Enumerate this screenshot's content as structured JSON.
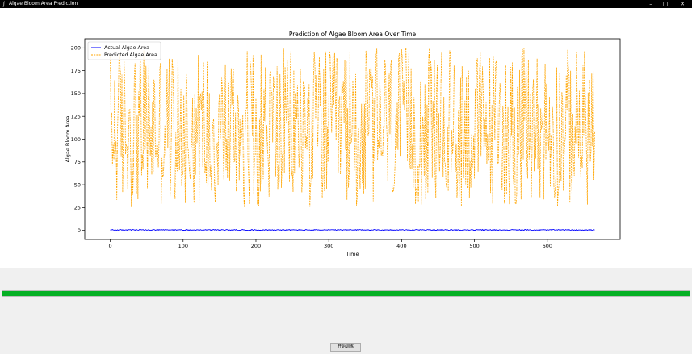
{
  "window": {
    "title": "Algae Bloom Area Prediction",
    "controls": {
      "minimize": "–",
      "maximize": "▢",
      "close": "✕"
    },
    "icon": "feather-icon"
  },
  "chart_data": {
    "type": "line",
    "title": "Prediction of Algae Bloom Area Over Time",
    "xlabel": "Time",
    "ylabel": "Algae Bloom Area",
    "xlim": [
      -35,
      700
    ],
    "ylim": [
      -10,
      210
    ],
    "xticks": [
      0,
      100,
      200,
      300,
      400,
      500,
      600
    ],
    "yticks": [
      0,
      25,
      50,
      75,
      100,
      125,
      150,
      175,
      200
    ],
    "grid": false,
    "legend_position": "top-left",
    "series": [
      {
        "name": "Actual Algae Area",
        "color": "#0000ff",
        "style": "solid",
        "n_points": 666,
        "values_summary": "approximately 0–1 throughout",
        "y_min": 0,
        "y_max": 1
      },
      {
        "name": "Predicted Algae Area",
        "color": "#ffa500",
        "style": "dashed",
        "n_points": 666,
        "values_summary": "oscillates between about 25 and 200",
        "y_min": 25,
        "y_max": 200
      }
    ]
  },
  "progress": {
    "value_percent": 100,
    "color": "#06b025"
  },
  "start_button": {
    "label": "开始训练"
  }
}
